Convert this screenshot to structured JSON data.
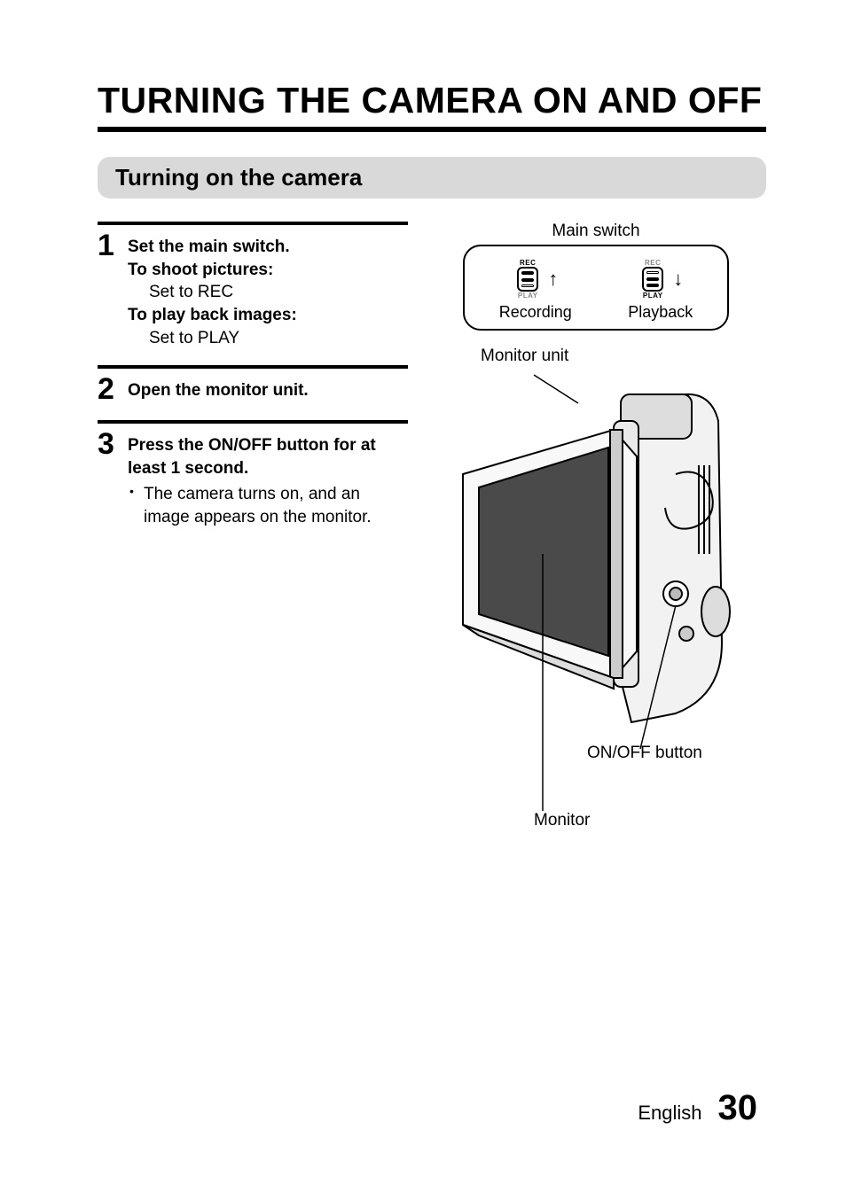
{
  "page": {
    "title": "TURNING THE CAMERA ON AND OFF",
    "section_heading": "Turning on the camera"
  },
  "steps": {
    "s1": {
      "num": "1",
      "line1": "Set the main switch.",
      "shoot_label": "To shoot pictures:",
      "shoot_action": "Set to REC",
      "play_label": "To play back images:",
      "play_action": "Set to PLAY"
    },
    "s2": {
      "num": "2",
      "line1": "Open the monitor unit."
    },
    "s3": {
      "num": "3",
      "line1": "Press the ON/OFF button for at least 1 second.",
      "bullet1": "The camera turns on, and an image appears on the monitor."
    }
  },
  "figure": {
    "main_switch_label": "Main switch",
    "rec_small": "REC",
    "play_small": "PLAY",
    "recording_caption": "Recording",
    "playback_caption": "Playback",
    "monitor_unit_label": "Monitor unit",
    "onoff_label": "ON/OFF button",
    "monitor_label": "Monitor"
  },
  "footer": {
    "lang": "English",
    "page_num": "30"
  }
}
